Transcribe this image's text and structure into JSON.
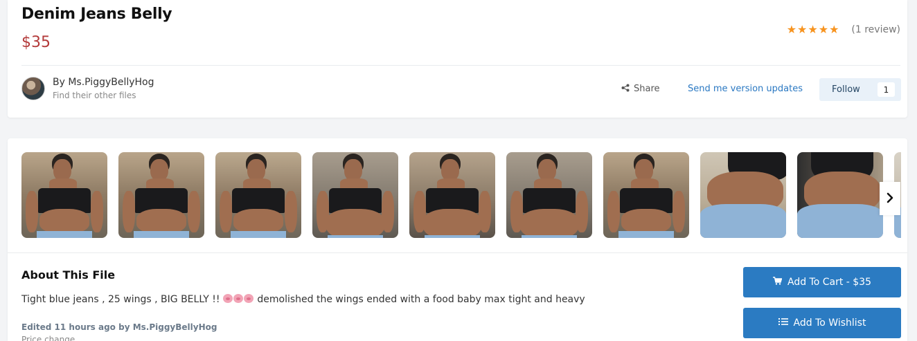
{
  "product": {
    "title": "Denim Jeans Belly",
    "price": "$35",
    "rating_stars": 5,
    "review_count": "(1 review)"
  },
  "author": {
    "by_line": "By Ms.PiggyBellyHog",
    "sub_link": "Find their other files"
  },
  "actions": {
    "share_label": "Share",
    "updates_label": "Send me version updates",
    "follow_label": "Follow",
    "follow_count": "1"
  },
  "gallery": {
    "thumbnail_count": 10,
    "next_icon": "chevron-right-icon"
  },
  "about": {
    "title": "About This File",
    "text_before_emoji": "Tight blue jeans , 25 wings , BIG BELLY !! ",
    "emoji_count": 3,
    "text_after_emoji": "  demolished the wings ended with a food baby max tight and heavy",
    "edited": "Edited 11 hours ago by Ms.PiggyBellyHog",
    "edited_note": "Price change"
  },
  "buttons": {
    "cart_label": "Add To Cart - $35",
    "wishlist_label": "Add To Wishlist"
  },
  "colors": {
    "price": "#b33a3a",
    "star": "#f7931e",
    "accent": "#2b7bc2",
    "link": "#2a78c2"
  }
}
